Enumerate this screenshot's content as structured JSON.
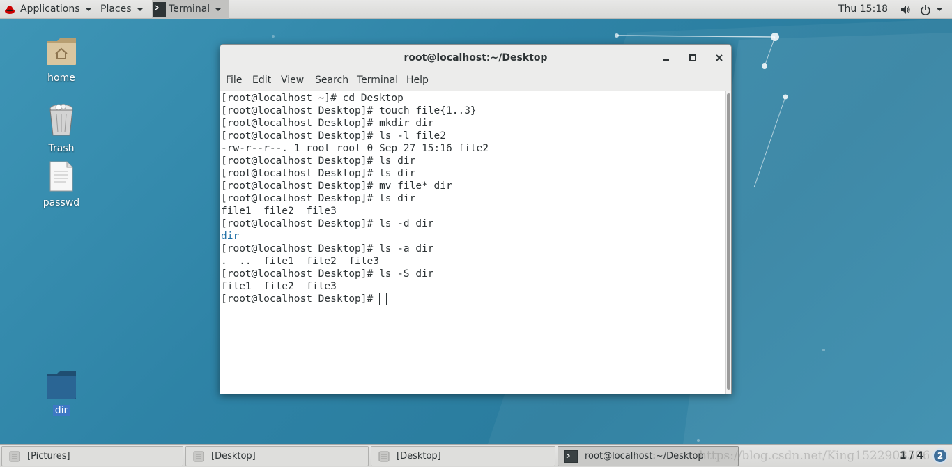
{
  "topbar": {
    "applications_label": "Applications",
    "places_label": "Places",
    "terminal_label": "Terminal",
    "clock": "Thu 15:18"
  },
  "desktop": {
    "icons": [
      {
        "label": "home"
      },
      {
        "label": "Trash"
      },
      {
        "label": "passwd"
      },
      {
        "label": "dir"
      }
    ]
  },
  "terminal_window": {
    "title": "root@localhost:~/Desktop",
    "menu": [
      "File",
      "Edit",
      "View",
      "Search",
      "Terminal",
      "Help"
    ],
    "lines": [
      "[root@localhost ~]# cd Desktop",
      "[root@localhost Desktop]# touch file{1..3}",
      "[root@localhost Desktop]# mkdir dir",
      "[root@localhost Desktop]# ls -l file2",
      "-rw-r--r--. 1 root root 0 Sep 27 15:16 file2",
      "[root@localhost Desktop]# ls dir",
      "[root@localhost Desktop]# ls dir",
      "[root@localhost Desktop]# mv file* dir",
      "[root@localhost Desktop]# ls dir",
      "file1  file2  file3",
      "[root@localhost Desktop]# ls -d dir",
      "dir",
      "[root@localhost Desktop]# ls -a dir",
      ".  ..  file1  file2  file3",
      "[root@localhost Desktop]# ls -S dir",
      "file1  file2  file3",
      "[root@localhost Desktop]# "
    ],
    "highlighted_line_color": "#1f6fa5"
  },
  "taskbar": {
    "tasks": [
      "[Pictures]",
      "[Desktop]",
      "[Desktop]",
      "root@localhost:~/Desktop"
    ],
    "watermark": "https://blog.csdn.net/King15229085063",
    "pager": "1 / 4",
    "notifications_count": "2"
  },
  "colors": {
    "desktop_bg": "#2f7fa0",
    "panel_bg": "#dededc",
    "terminal_text": "#2e3436"
  }
}
